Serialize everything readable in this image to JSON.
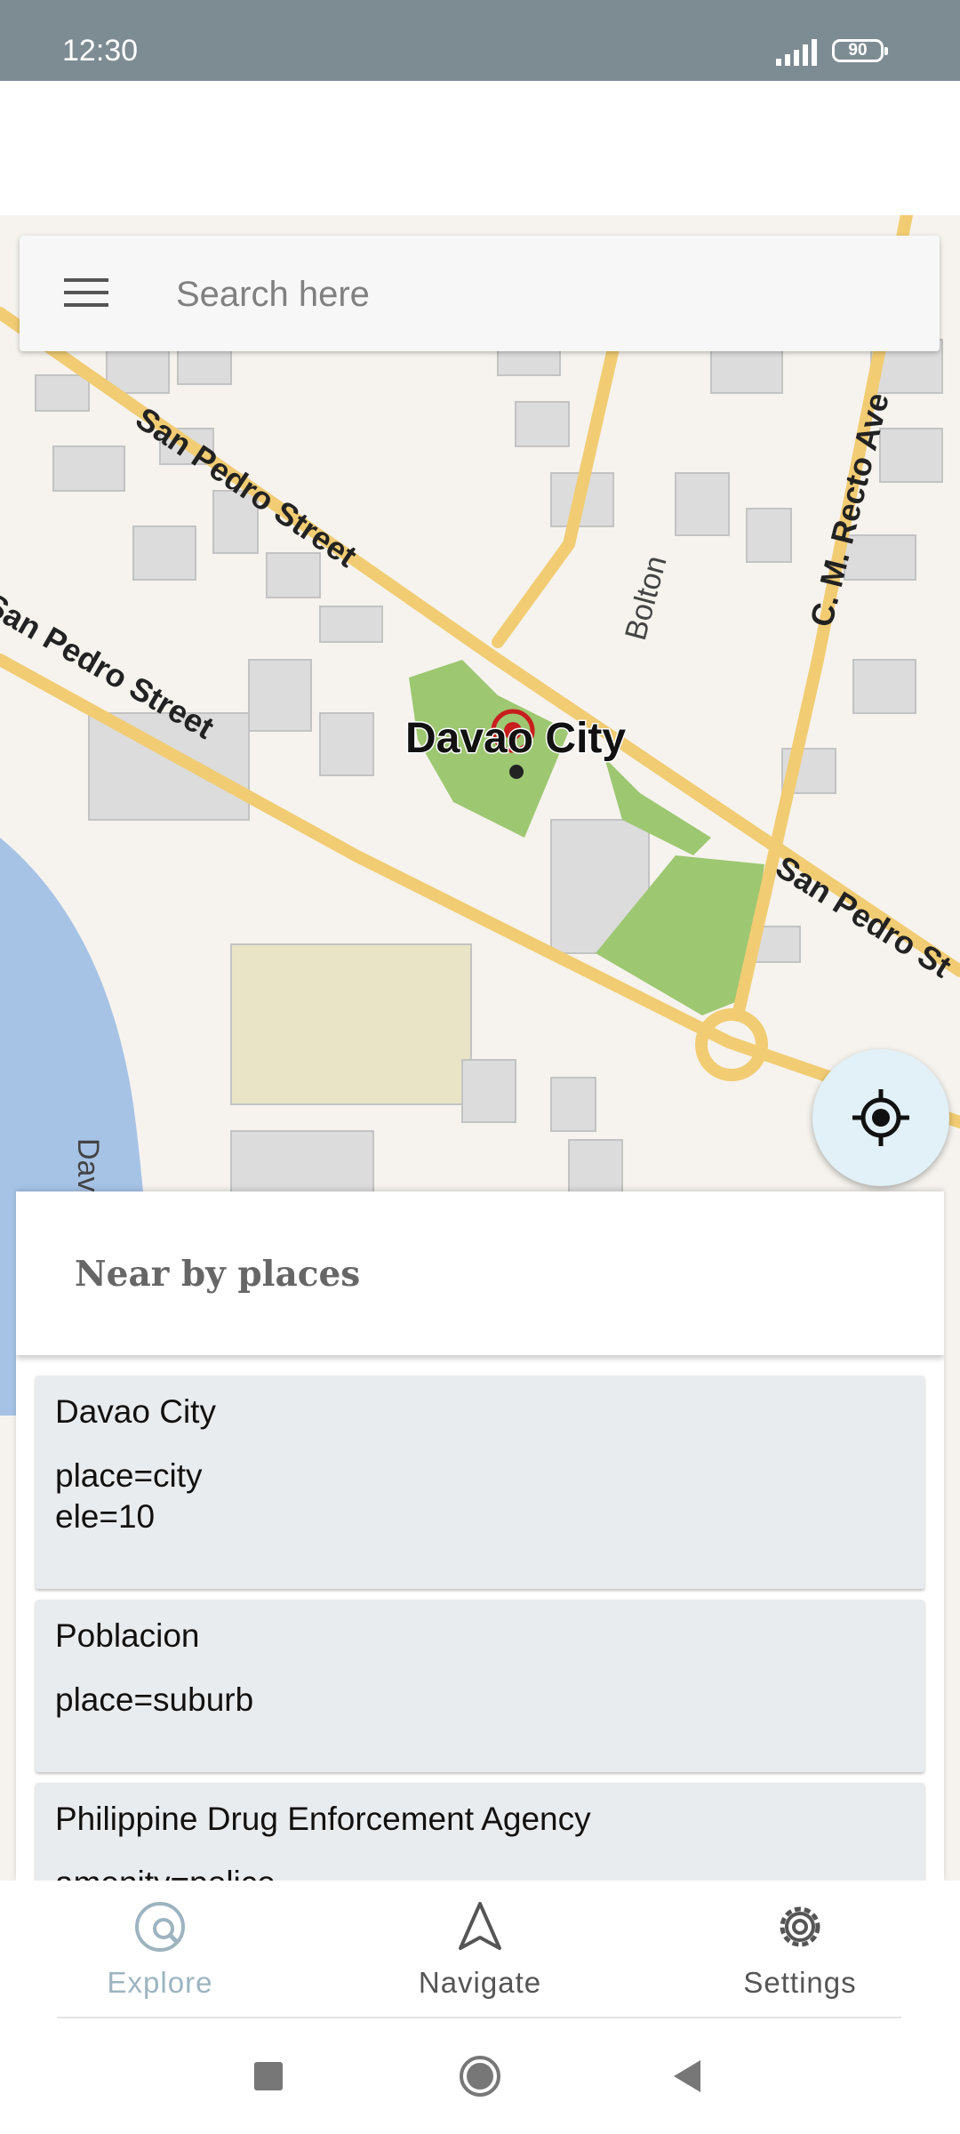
{
  "status": {
    "time": "12:30",
    "battery": "90"
  },
  "search": {
    "placeholder": "Search here"
  },
  "map": {
    "city_label": "Davao City",
    "streets": [
      "San Pedro Street",
      "San Pedro Street",
      "San Pedro St",
      "C. M. Recto Ave",
      "Bolton",
      "Dav"
    ]
  },
  "sheet": {
    "title": "Near by places",
    "places": [
      {
        "name": "Davao City",
        "tags": [
          "place=city",
          "ele=10"
        ]
      },
      {
        "name": "Poblacion",
        "tags": [
          "place=suburb"
        ]
      },
      {
        "name": "Philippine Drug Enforcement Agency",
        "tags": [
          "amenity=police"
        ]
      }
    ]
  },
  "nav": {
    "explore": "Explore",
    "navigate": "Navigate",
    "settings": "Settings",
    "active_color": "#9db4c0",
    "inactive_color": "#555555"
  }
}
